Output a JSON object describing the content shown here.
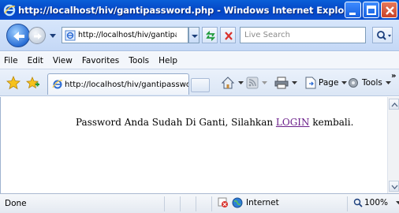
{
  "window": {
    "title": "http://localhost/hiv/gantipassword.php - Windows Internet Explorer",
    "title_icon": "ie-icon",
    "buttons": [
      "minimize-icon",
      "maximize-icon",
      "close-icon"
    ]
  },
  "address_bar": {
    "url": "http://localhost/hiv/gantipasswo",
    "search_placeholder": "Live Search"
  },
  "menu": {
    "items": [
      "File",
      "Edit",
      "View",
      "Favorites",
      "Tools",
      "Help"
    ]
  },
  "tab": {
    "label": "http://localhost/hiv/gantipassword..."
  },
  "commands": {
    "page_label": "Page",
    "tools_label": "Tools",
    "more": "»"
  },
  "content": {
    "message_before": "Password Anda Sudah Di Ganti, Silahkan ",
    "link_text": "LOGIN",
    "message_after": " kembali."
  },
  "status": {
    "text": "Done",
    "zone": "Internet",
    "zoom": "100%"
  },
  "colors": {
    "titlebar": "#0445c4",
    "link_visited": "#6b1f8a"
  }
}
